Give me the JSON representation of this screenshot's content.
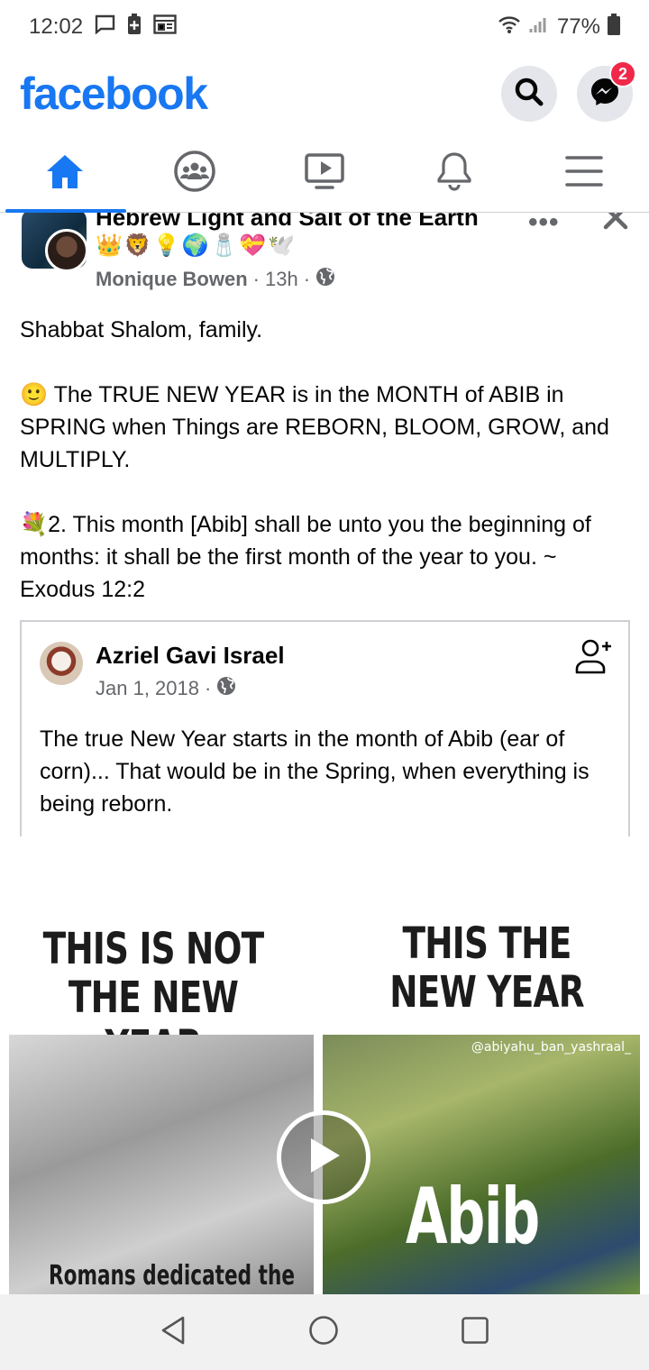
{
  "status_bar": {
    "time": "12:02",
    "battery": "77%"
  },
  "header": {
    "logo": "facebook",
    "messenger_badge": "2"
  },
  "tabs": [
    {
      "name": "home",
      "active": true
    },
    {
      "name": "groups",
      "active": false
    },
    {
      "name": "watch",
      "active": false
    },
    {
      "name": "notifications",
      "active": false
    },
    {
      "name": "menu",
      "active": false
    }
  ],
  "post": {
    "group_name": "Hebrew Light and Salt of the Earth",
    "group_emojis": "👑🦁💡🌍🧂💝🕊️",
    "author": "Monique Bowen",
    "time": "13h",
    "body": [
      "Shabbat Shalom, family.",
      "🙂 The TRUE NEW YEAR  is in the MONTH of ABIB in SPRING when Things are REBORN, BLOOM, GROW, and MULTIPLY.",
      "💐2. This month [Abib] shall be unto you the beginning of months: it shall be the first month of the year to you. ~ Exodus 12:2"
    ]
  },
  "shared_post": {
    "author": "Azriel Gavi Israel",
    "date": "Jan 1, 2018",
    "text": "The true New Year starts in the month of Abib (ear of corn)... That would be in the Spring, when everything is being reborn."
  },
  "video": {
    "left_heading": "THIS IS NOT THE NEW YEAR",
    "right_heading": "THIS THE NEW YEAR",
    "watermark": "@abiyahu_ban_yashraal_",
    "overlay_word": "Abib",
    "bottom_caption": "Romans dedicated the"
  },
  "colors": {
    "brand": "#1877f2",
    "badge": "#f02849",
    "secondary_text": "#65676b"
  }
}
